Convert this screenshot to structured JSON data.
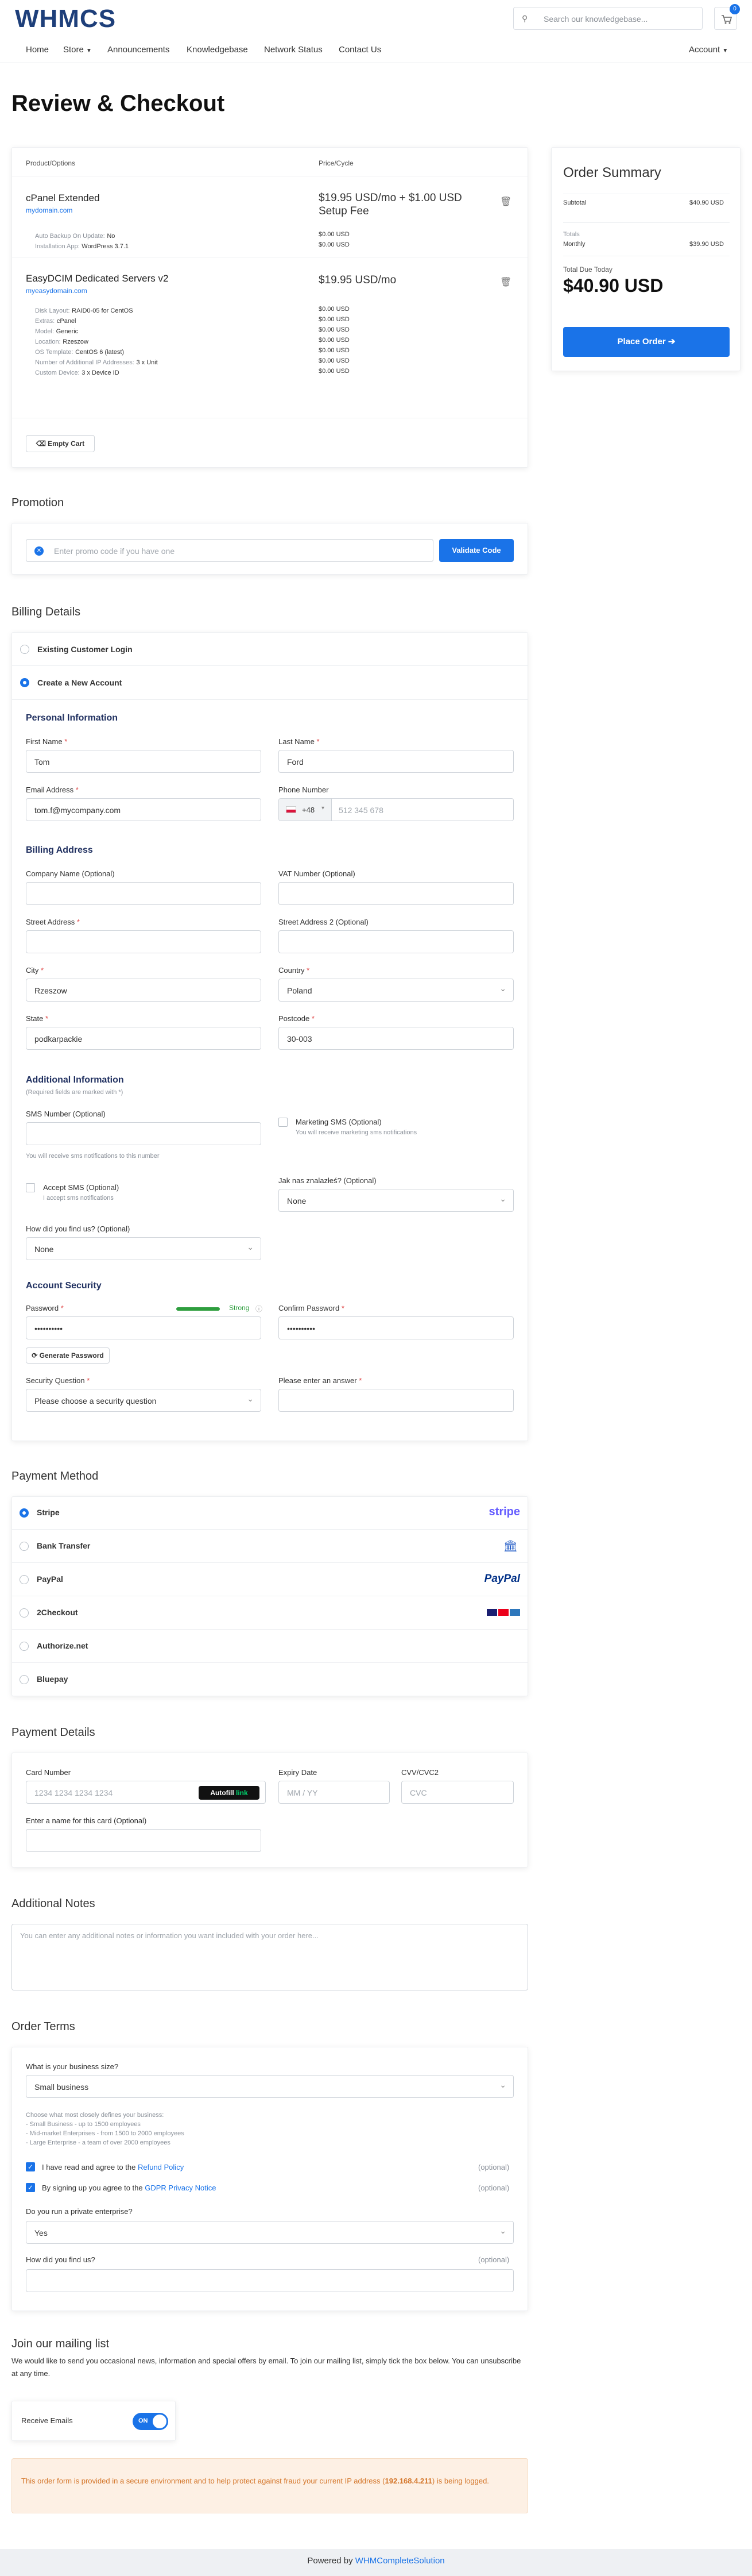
{
  "brand": {
    "logo": "WHMCS"
  },
  "search": {
    "placeholder": "Search our knowledgebase..."
  },
  "cart": {
    "count": "0"
  },
  "nav": {
    "home": "Home",
    "store": "Store",
    "announcements": "Announcements",
    "knowledgebase": "Knowledgebase",
    "network_status": "Network Status",
    "contact": "Contact Us",
    "account": "Account"
  },
  "page_title": "Review & Checkout",
  "cart_table": {
    "col_product": "Product/Options",
    "col_price": "Price/Cycle",
    "items": [
      {
        "name": "cPanel Extended",
        "domain": "mydomain.com",
        "price": "$19.95 USD/mo + $1.00 USD Setup Fee",
        "options": [
          {
            "label": "Auto Backup On Update:",
            "value": "No",
            "price": "$0.00 USD"
          },
          {
            "label": "Installation App:",
            "value": "WordPress 3.7.1",
            "price": "$0.00 USD"
          }
        ]
      },
      {
        "name": "EasyDCIM Dedicated Servers v2",
        "domain": "myeasydomain.com",
        "price": "$19.95 USD/mo",
        "options": [
          {
            "label": "Disk Layout:",
            "value": "RAID0-05 for CentOS",
            "price": "$0.00 USD"
          },
          {
            "label": "Extras:",
            "value": "cPanel",
            "price": "$0.00 USD"
          },
          {
            "label": "Model:",
            "value": "Generic",
            "price": "$0.00 USD"
          },
          {
            "label": "Location:",
            "value": "Rzeszow",
            "price": "$0.00 USD"
          },
          {
            "label": "OS Template:",
            "value": "CentOS 6 (latest)",
            "price": "$0.00 USD"
          },
          {
            "label": "Number of Additional IP Addresses:",
            "value": "3 x Unit",
            "price": "$0.00 USD"
          },
          {
            "label": "Custom Device:",
            "value": "3 x Device ID",
            "price": "$0.00 USD"
          }
        ]
      }
    ],
    "empty_cart": "Empty Cart"
  },
  "summary": {
    "title": "Order Summary",
    "subtotal_label": "Subtotal",
    "subtotal": "$40.90 USD",
    "totals_label": "Totals",
    "monthly_label": "Monthly",
    "monthly": "$39.90 USD",
    "due_label": "Total Due Today",
    "due": "$40.90 USD",
    "place_order": "Place Order"
  },
  "promotion": {
    "title": "Promotion",
    "placeholder": "Enter promo code if you have one",
    "button": "Validate Code"
  },
  "billing": {
    "title": "Billing Details",
    "existing": "Existing Customer Login",
    "create": "Create a New Account",
    "personal_title": "Personal Information",
    "first_name_label": "First Name",
    "first_name": "Tom",
    "last_name_label": "Last Name",
    "last_name": "Ford",
    "email_label": "Email Address",
    "email": "tom.f@mycompany.com",
    "phone_label": "Phone Number",
    "phone_code": "+48",
    "phone_placeholder": "512 345 678",
    "address_title": "Billing Address",
    "company_label": "Company Name (Optional)",
    "vat_label": "VAT Number (Optional)",
    "street_label": "Street Address",
    "street2_label": "Street Address 2 (Optional)",
    "city_label": "City",
    "city": "Rzeszow",
    "country_label": "Country",
    "country": "Poland",
    "state_label": "State",
    "state": "podkarpackie",
    "postcode_label": "Postcode",
    "postcode": "30-003",
    "additional_title": "Additional Information",
    "required_note": "(Required fields are marked with *)",
    "sms_label": "SMS Number (Optional)",
    "sms_help": "You will receive sms notifications to this number",
    "marketing_label": "Marketing SMS (Optional)",
    "marketing_help": "You will receive marketing sms notifications",
    "accept_sms_label": "Accept SMS (Optional)",
    "accept_sms_help": "I accept sms notifications",
    "jak_label": "Jak nas znalazłeś? (Optional)",
    "jak_value": "None",
    "how_label": "How did you find us? (Optional)",
    "how_value": "None",
    "security_title": "Account Security",
    "password_label": "Password",
    "strength": "Strong",
    "password": "••••••••••",
    "confirm_label": "Confirm Password",
    "confirm": "••••••••••",
    "generate": "Generate Password",
    "question_label": "Security Question",
    "question_value": "Please choose a security question",
    "answer_label": "Please enter an answer"
  },
  "payment": {
    "title": "Payment Method",
    "methods": [
      "Stripe",
      "Bank Transfer",
      "PayPal",
      "2Checkout",
      "Authorize.net",
      "Bluepay"
    ],
    "stripe_logo": "stripe",
    "paypal_logo": "PayPal"
  },
  "card": {
    "title": "Payment Details",
    "number_label": "Card Number",
    "number_placeholder": "1234 1234 1234 1234",
    "autofill": "Autofill",
    "autofill_brand": "link",
    "expiry_label": "Expiry Date",
    "expiry_placeholder": "MM / YY",
    "cvv_label": "CVV/CVC2",
    "cvv_placeholder": "CVC",
    "name_label": "Enter a name for this card (Optional)"
  },
  "notes": {
    "title": "Additional Notes",
    "placeholder": "You can enter any additional notes or information you want included with your order here..."
  },
  "terms": {
    "title": "Order Terms",
    "size_label": "What is your business size?",
    "size_value": "Small business",
    "size_help": [
      "Choose what most closely defines your business:",
      "- Small Business - up to 1500 employees",
      "- Mid-market Enterprises - from 1500 to 2000 employees",
      "- Large Enterprise - a team of over 2000 employees"
    ],
    "refund_text": "I have read and agree to the",
    "refund_link": "Refund Policy",
    "gdpr_text": "By signing up you agree to the",
    "gdpr_link": "GDPR Privacy Notice",
    "optional": "(optional)",
    "private_label": "Do you run a private enterprise?",
    "private_value": "Yes",
    "find_label": "How did you find us?"
  },
  "mailing": {
    "title": "Join our mailing list",
    "text": "We would like to send you occasional news, information and special offers by email. To join our mailing list, simply tick the box below. You can unsubscribe at any time.",
    "receive": "Receive Emails",
    "toggle": "ON"
  },
  "notice": {
    "text1": "This order form is provided in a secure environment and to help protect against fraud your current IP address (",
    "ip": "192.168.4.211",
    "text2": ") is being logged."
  },
  "footer": {
    "powered": "Powered by",
    "link": "WHMCompleteSolution"
  },
  "colors": {
    "primary": "#1a73e8",
    "brand_navy": "#1e3f7a",
    "brand_green": "#7ac142",
    "notice_bg": "#fdf0e4"
  }
}
